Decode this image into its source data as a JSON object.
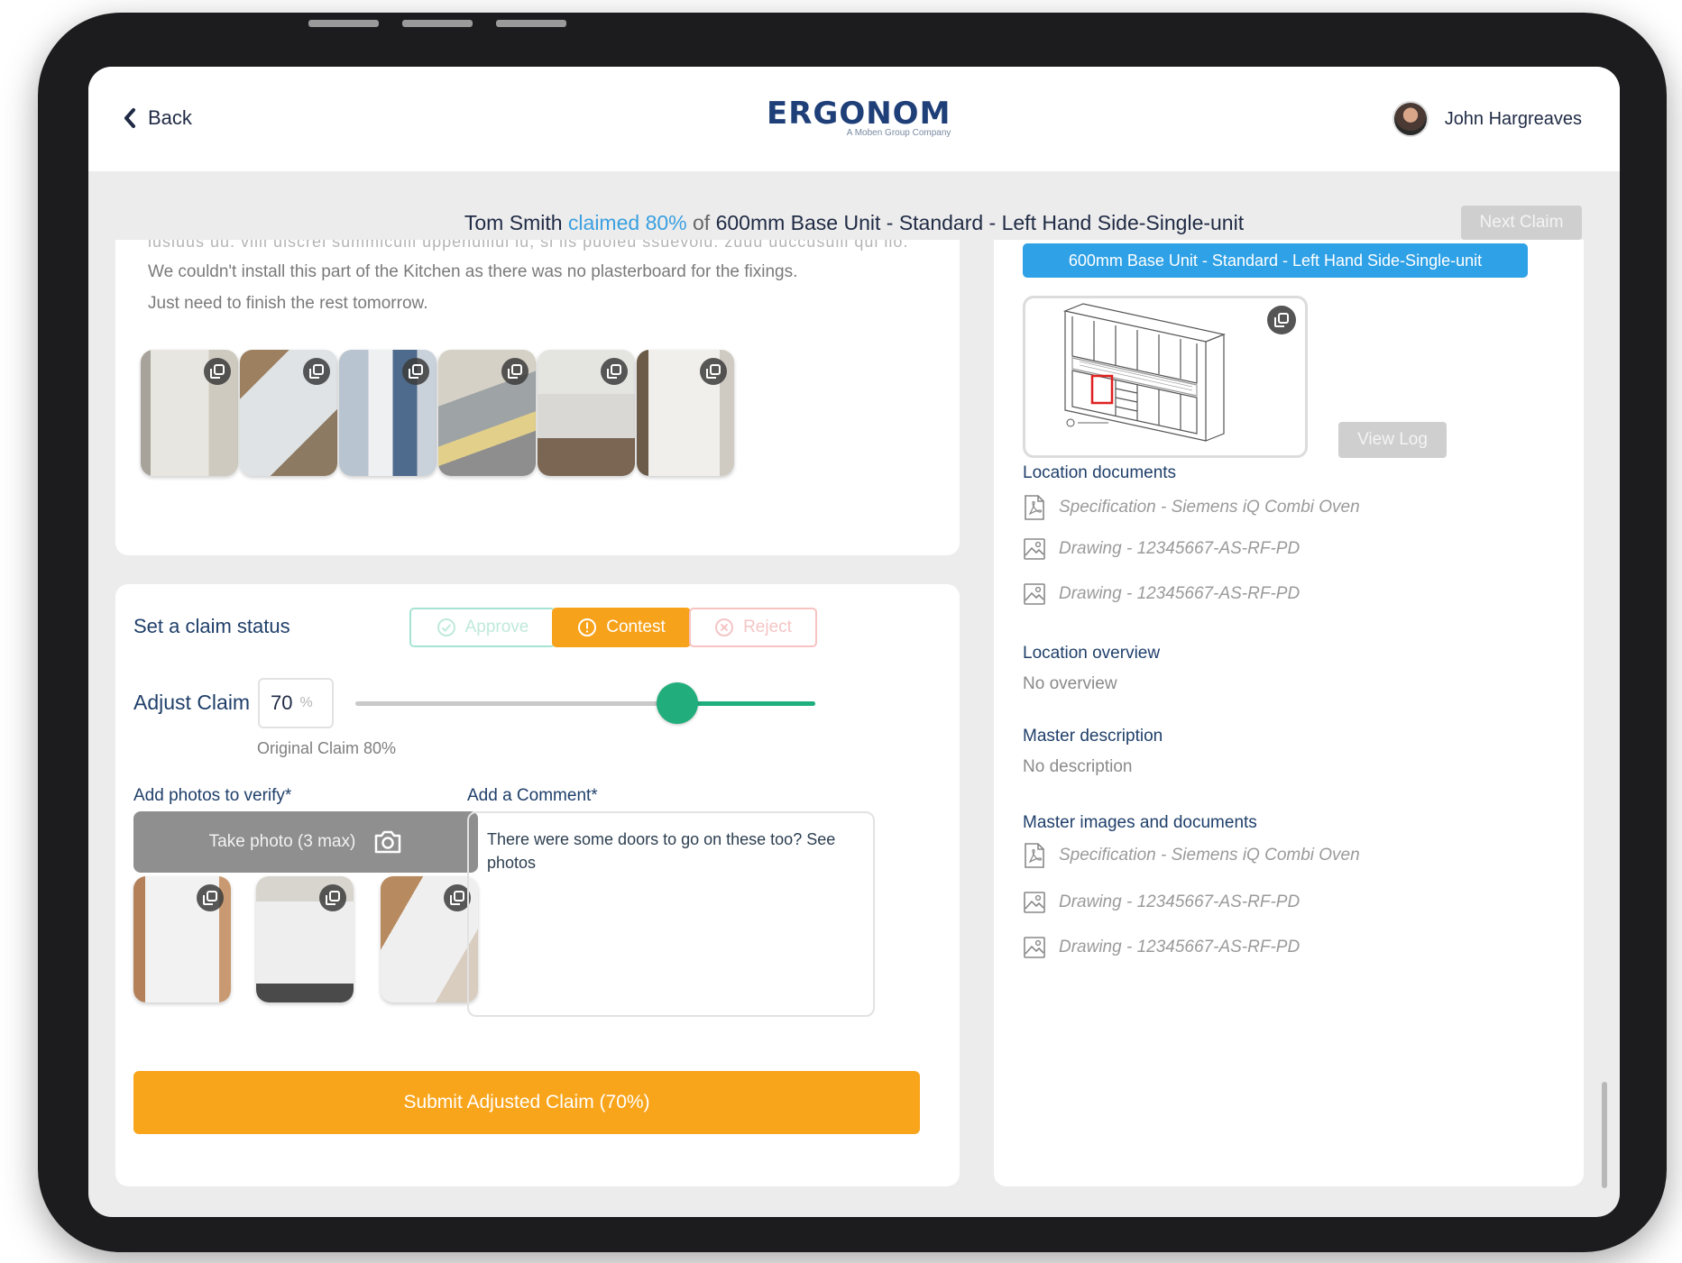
{
  "header": {
    "back_label": "Back",
    "logo": "ERGONOM",
    "logo_tagline": "A Moben Group Company",
    "user_name": "John Hargreaves"
  },
  "claim": {
    "claimant": "Tom Smith",
    "claimed_text": "claimed 80%",
    "of_text": "of",
    "unit": "600mm Base Unit - Standard - Left Hand Side-Single-unit",
    "next_label": "Next Claim"
  },
  "report": {
    "cutoff_text": "iusiuus uu. viiii uiscrei summicuiii uppenuiiiui iu, si iis puoieu ssuevoiu. zuuu uuccusuiii qui iio.",
    "description_line1": "We couldn't install this part of the Kitchen as there was no plasterboard for the fixings.",
    "description_line2": "Just need to finish the rest tomorrow.",
    "photo_count": 6
  },
  "status": {
    "label": "Set a claim status",
    "approve": "Approve",
    "contest": "Contest",
    "reject": "Reject",
    "selected": "contest"
  },
  "adjust": {
    "label": "Adjust Claim",
    "value": "70",
    "unit": "%",
    "slider_value": 70,
    "original": "Original Claim 80%"
  },
  "verify": {
    "photos_label": "Add photos to verify*",
    "take_photo": "Take photo (3 max)",
    "comment_label": "Add a Comment*",
    "comment_text": "There were some doors to go on these too? See photos"
  },
  "submit_label": "Submit Adjusted Claim (70%)",
  "right_panel": {
    "unit_tag": "600mm Base Unit - Standard - Left Hand Side-Single-unit",
    "view_log": "View Log",
    "location_docs_title": "Location documents",
    "location_docs": [
      "Specification - Siemens iQ Combi Oven",
      "Drawing - 12345667-AS-RF-PD",
      "Drawing - 12345667-AS-RF-PD"
    ],
    "overview_title": "Location overview",
    "overview_text": "No overview",
    "master_desc_title": "Master description",
    "master_desc_text": "No description",
    "master_docs_title": "Master images and documents",
    "master_docs": [
      "Specification - Siemens iQ Combi Oven",
      "Drawing - 12345667-AS-RF-PD",
      "Drawing - 12345667-AS-RF-PD"
    ]
  },
  "colors": {
    "brand_navy": "#1f3f78",
    "accent_blue": "#3aa0e0",
    "contest_orange": "#f7a21b",
    "submit_orange": "#f9a51c",
    "slider_green": "#1fae7e"
  }
}
